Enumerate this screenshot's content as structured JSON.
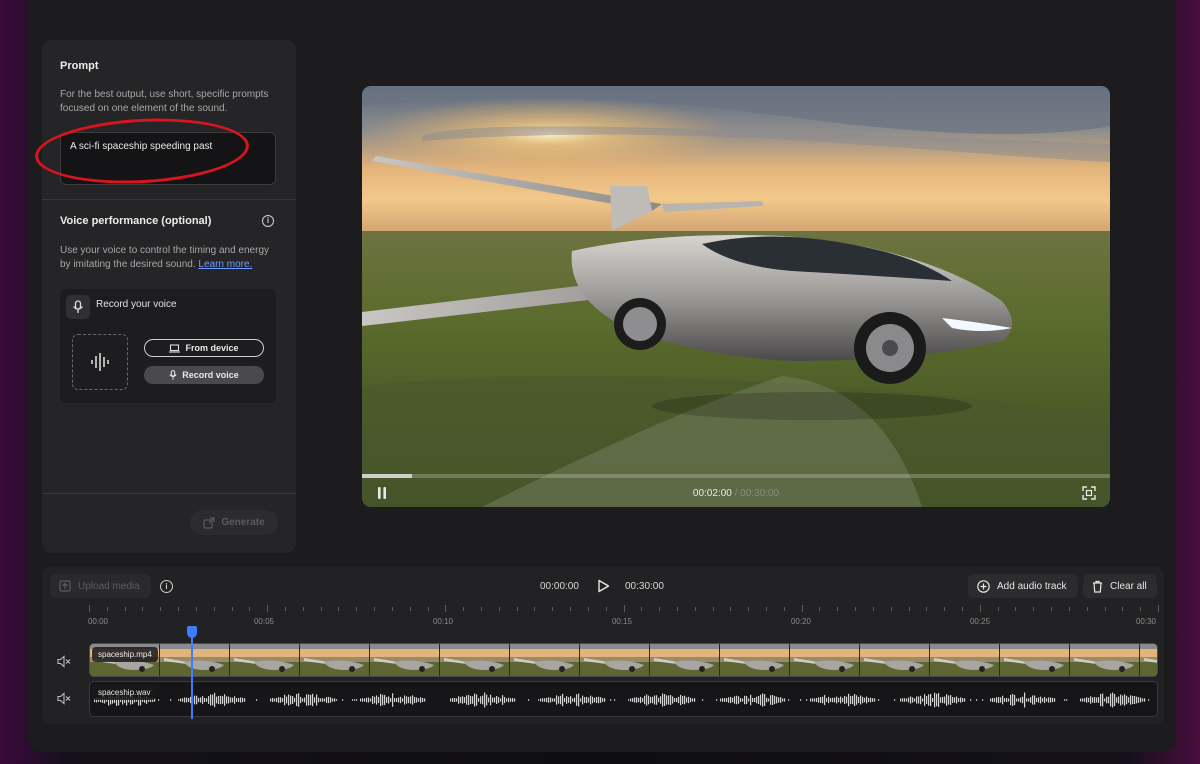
{
  "prompt_panel": {
    "title": "Prompt",
    "help": "For the best output, use short, specific prompts focused on one element of the sound.",
    "value": "A sci-fi spaceship speeding past"
  },
  "voice_panel": {
    "title": "Voice performance (optional)",
    "info_icon": "i",
    "help": "Use your voice to control the timing and energy by imitating the desired sound.",
    "learn_more": "Learn more.",
    "record_title": "Record your voice",
    "from_device": "From device",
    "record_voice": "Record voice"
  },
  "generate_label": "Generate",
  "video": {
    "current_time": "00:02:00",
    "separator": "/",
    "total_time": "00:30:00",
    "progress": 0.067
  },
  "timeline": {
    "upload_label": "Upload media",
    "start_time": "00:00:00",
    "end_time": "00:30:00",
    "add_audio_label": "Add audio track",
    "clear_all_label": "Clear all",
    "ruler": [
      "00:00",
      "00:05",
      "00:10",
      "00:15",
      "00:20",
      "00:25",
      "00:30"
    ],
    "tracks": [
      {
        "name": "spaceship.mp4",
        "kind": "video"
      },
      {
        "name": "spaceship.wav",
        "kind": "audio"
      }
    ],
    "playhead_fraction": 0.097
  },
  "colors": {
    "accent": "#3f7bff",
    "annotation": "#d8151e",
    "link": "#6f9dff"
  }
}
